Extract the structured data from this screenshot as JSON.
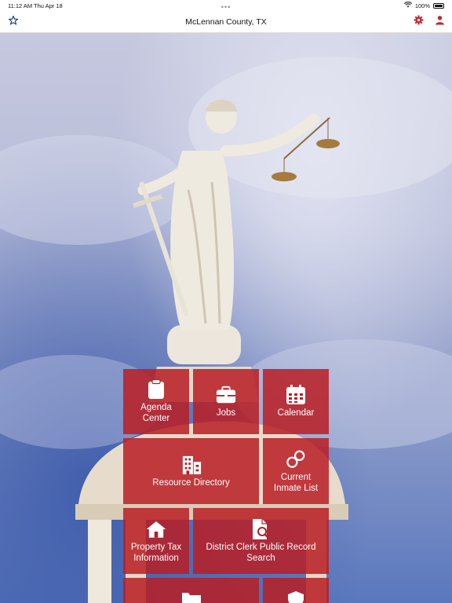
{
  "status_bar": {
    "time": "11:12 AM",
    "date": "Thu Apr 18",
    "battery": "100%"
  },
  "nav": {
    "title": "McLennan County, TX"
  },
  "icons": {
    "favorites": "star-icon",
    "settings": "gear-icon",
    "account": "user-icon",
    "agenda": "clipboard-icon",
    "jobs": "briefcase-icon",
    "calendar": "calendar-icon",
    "resources": "buildings-icon",
    "inmates": "handcuffs-icon",
    "property_tax": "house-icon",
    "district_clerk": "document-search-icon"
  },
  "colors": {
    "accent": "#c0262d",
    "nav_star": "#1f3c8a",
    "tile": "#b91e24"
  },
  "tiles": {
    "agenda_center": "Agenda Center",
    "jobs": "Jobs",
    "calendar": "Calendar",
    "resource_directory": "Resource Directory",
    "current_inmate_list": "Current Inmate List",
    "property_tax_information": "Property Tax Information",
    "district_clerk_public_record_search": "District Clerk Public Record Search"
  }
}
